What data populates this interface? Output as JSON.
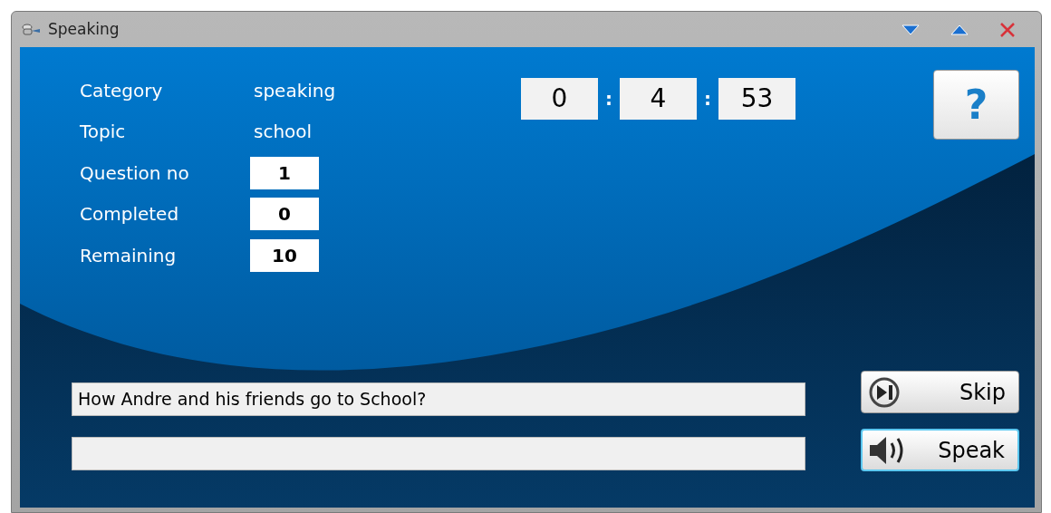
{
  "window": {
    "title": "Speaking"
  },
  "info": [
    {
      "label": "Category",
      "value": "speaking",
      "kind": "text"
    },
    {
      "label": "Topic",
      "value": "school",
      "kind": "text"
    },
    {
      "label": "Question no",
      "value": "1",
      "kind": "box"
    },
    {
      "label": "Completed",
      "value": "0",
      "kind": "box"
    },
    {
      "label": "Remaining",
      "value": "10",
      "kind": "box"
    }
  ],
  "timer": {
    "parts": [
      "0",
      "4",
      "53"
    ],
    "separators": [
      ":",
      ":"
    ]
  },
  "help_button": {
    "label": "?"
  },
  "question": {
    "value": "How Andre and his friends go to School?"
  },
  "buttons": [
    {
      "kind": "skip",
      "label": "Skip",
      "focused": false
    },
    {
      "kind": "speak",
      "label": "Speak",
      "focused": true
    }
  ]
}
